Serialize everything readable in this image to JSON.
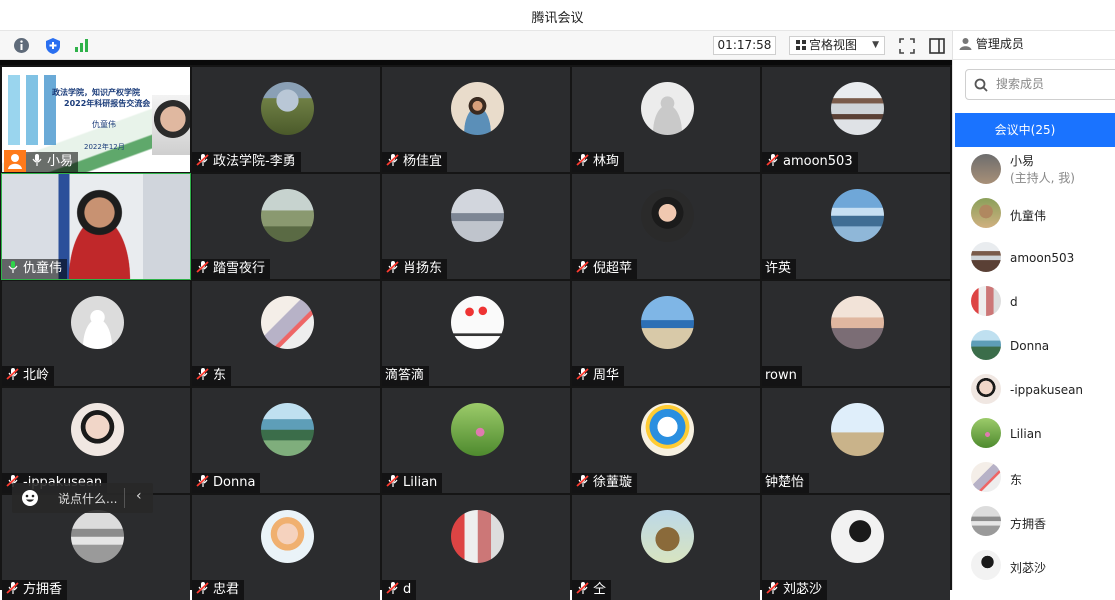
{
  "window": {
    "title": "腾讯会议"
  },
  "toolbar": {
    "timer": "01:17:58",
    "view_label": "宫格视图"
  },
  "sidebar": {
    "header": "管理成员",
    "search_placeholder": "搜索成员",
    "tab": "会议中(25)",
    "members": [
      {
        "name": "小易",
        "sub": "(主持人, 我)"
      },
      {
        "name": "仇童伟"
      },
      {
        "name": "amoon503"
      },
      {
        "name": "d"
      },
      {
        "name": "Donna"
      },
      {
        "name": "-ippakusean"
      },
      {
        "name": "Lilian"
      },
      {
        "name": "东"
      },
      {
        "name": "方拥香"
      },
      {
        "name": "刘苾沙"
      }
    ]
  },
  "slide": {
    "line1": "政法学院，知识产权学院",
    "line2": "2022年科研报告交流会",
    "line3": "仇童伟",
    "line4": "2022年12月"
  },
  "tiles": [
    {
      "name": "小易"
    },
    {
      "name": "政法学院-李勇"
    },
    {
      "name": "杨佳宜"
    },
    {
      "name": "林珣"
    },
    {
      "name": "amoon503"
    },
    {
      "name": "仇童伟"
    },
    {
      "name": "踏雪夜行"
    },
    {
      "name": "肖扬东"
    },
    {
      "name": "倪超苹"
    },
    {
      "name": "许英"
    },
    {
      "name": "北岭"
    },
    {
      "name": "东"
    },
    {
      "name": "滴答滴"
    },
    {
      "name": "周华"
    },
    {
      "name": "rown"
    },
    {
      "name": "-ippakusean"
    },
    {
      "name": "Donna"
    },
    {
      "name": "Lilian"
    },
    {
      "name": "徐蕫璇"
    },
    {
      "name": "钟楚怡"
    },
    {
      "name": "方拥香"
    },
    {
      "name": "忠君"
    },
    {
      "name": "d"
    },
    {
      "name": "仝"
    },
    {
      "name": "刘苾沙"
    }
  ],
  "chat": {
    "placeholder": "说点什么..."
  }
}
